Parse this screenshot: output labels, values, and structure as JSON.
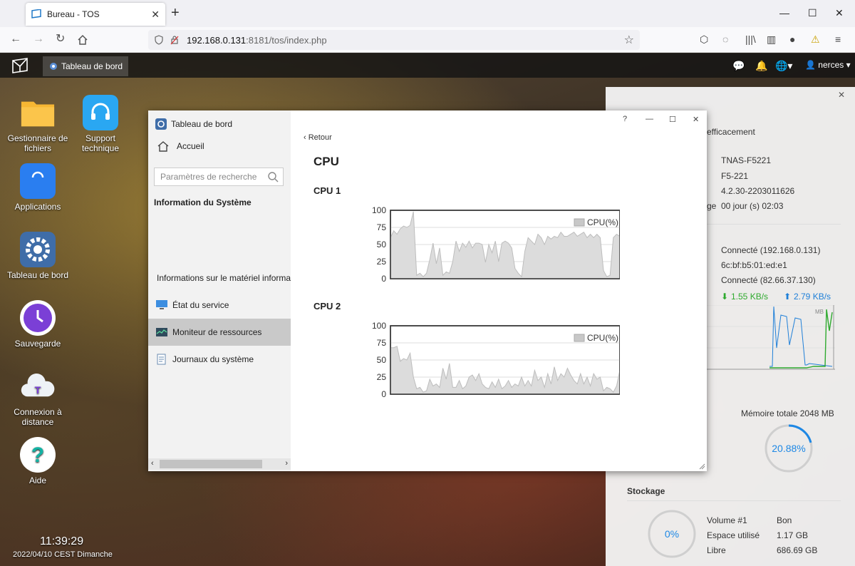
{
  "browser": {
    "tab_title": "Bureau - TOS",
    "tab_close": "✕",
    "new_tab": "+",
    "url_host": "192.168.0.131",
    "url_rest": ":8181/tos/index.php"
  },
  "tos": {
    "taskbar_item": "Tableau de bord",
    "user": "nerces",
    "clock": "11:39:29",
    "date": "2022/04/10 CEST Dimanche"
  },
  "desktop_icons": [
    {
      "label": "Gestionnaire de fichiers"
    },
    {
      "label": "Support technique"
    },
    {
      "label": "Applications"
    },
    {
      "label": "Tableau de bord"
    },
    {
      "label": "Sauvegarde"
    },
    {
      "label": "Connexion à distance"
    },
    {
      "label": "Aide"
    }
  ],
  "widget": {
    "efficiency": "efficacement",
    "model": "TNAS-F5221",
    "name": "F5-221",
    "version": "4.2.30-2203011626",
    "uptime_label_tail": "ge",
    "uptime": "00 jour (s) 02:03",
    "net_connected": "Connecté (192.168.0.131)",
    "mac": "6c:bf:b5:01:ed:e1",
    "wan_connected": "Connecté (82.66.37.130)",
    "down_speed": "1.55 KB/s",
    "up_speed": "2.79 KB/s",
    "net_unit": "MB",
    "memory_total": "Mémoire totale 2048 MB",
    "memory_pct": "20.88%",
    "memory_value": 20.88,
    "storage_title": "Stockage",
    "storage_pct": "0%",
    "volume_name": "Volume #1",
    "volume_status": "Bon",
    "used_label": "Espace utilisé",
    "used_value": "1.17 GB",
    "free_label": "Libre",
    "free_value": "686.69 GB",
    "colors": {
      "down": "#2faa2f",
      "up": "#1e7fd8",
      "ring": "#1e88e5"
    }
  },
  "window": {
    "title": "Tableau de bord",
    "help": "?",
    "home": "Accueil",
    "search_placeholder": "Paramètres de recherche",
    "section": "Information du Système",
    "items": [
      {
        "label": "Informations sur le matériel informa"
      },
      {
        "label": "État du service"
      },
      {
        "label": "Moniteur de ressources"
      },
      {
        "label": "Journaux du système"
      }
    ],
    "back": "Retour",
    "heading": "CPU",
    "cpu1": "CPU 1",
    "cpu2": "CPU 2"
  },
  "chart_data": [
    {
      "type": "area",
      "title": "CPU 1",
      "legend": "CPU(%)",
      "legend_position": "top-right",
      "ylim": [
        0,
        100
      ],
      "yticks": [
        0,
        25,
        50,
        75,
        100
      ],
      "grid": true,
      "values": [
        60,
        70,
        65,
        73,
        77,
        75,
        78,
        98,
        5,
        8,
        3,
        8,
        28,
        52,
        22,
        45,
        5,
        10,
        8,
        25,
        55,
        40,
        52,
        46,
        55,
        45,
        52,
        52,
        50,
        24,
        50,
        38,
        55,
        25,
        52,
        55,
        52,
        45,
        15,
        8,
        3,
        40,
        60,
        55,
        50,
        65,
        60,
        50,
        62,
        58,
        62,
        60,
        68,
        62,
        62,
        65,
        68,
        62,
        65,
        68,
        60,
        65,
        60,
        65,
        60,
        12,
        3,
        5,
        60,
        65,
        62
      ]
    },
    {
      "type": "area",
      "title": "CPU 2",
      "legend": "CPU(%)",
      "legend_position": "top-right",
      "ylim": [
        0,
        100
      ],
      "yticks": [
        0,
        25,
        50,
        75,
        100
      ],
      "grid": true,
      "values": [
        68,
        68,
        70,
        48,
        52,
        50,
        60,
        25,
        8,
        10,
        3,
        5,
        22,
        12,
        15,
        10,
        38,
        22,
        45,
        10,
        10,
        20,
        8,
        12,
        25,
        28,
        20,
        30,
        15,
        10,
        8,
        18,
        10,
        22,
        8,
        12,
        20,
        10,
        15,
        12,
        25,
        12,
        20,
        12,
        35,
        20,
        25,
        10,
        30,
        15,
        40,
        20,
        30,
        25,
        38,
        28,
        20,
        15,
        30,
        15,
        25,
        12,
        30,
        22,
        25,
        5,
        10,
        8,
        3,
        12,
        35
      ]
    }
  ]
}
